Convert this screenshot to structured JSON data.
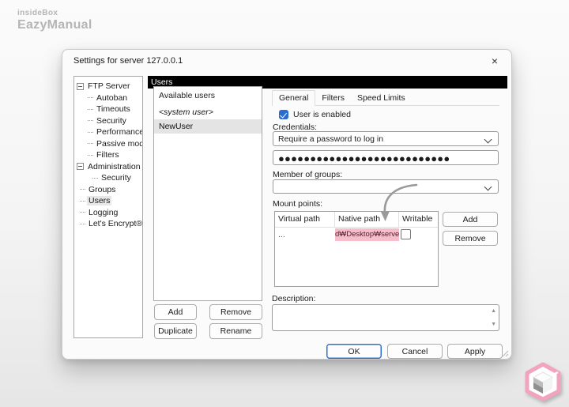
{
  "brand": {
    "line1": "insideBox",
    "line2": "EazyManual"
  },
  "dialog": {
    "title": "Settings for server 127.0.0.1",
    "close_icon": "×"
  },
  "tree": {
    "items": [
      {
        "label": "FTP Server"
      },
      {
        "label": "Autoban"
      },
      {
        "label": "Timeouts"
      },
      {
        "label": "Security"
      },
      {
        "label": "Performance"
      },
      {
        "label": "Passive mode"
      },
      {
        "label": "Filters"
      },
      {
        "label": "Administration"
      },
      {
        "label": "Security"
      },
      {
        "label": "Groups"
      },
      {
        "label": "Users"
      },
      {
        "label": "Logging"
      },
      {
        "label": "Let's Encrypt®"
      }
    ],
    "selected": "Users"
  },
  "users_panel": {
    "header": "Users",
    "list_title": "Available users",
    "items": [
      {
        "label": "<system user>",
        "selected": false
      },
      {
        "label": "NewUser",
        "selected": true
      }
    ],
    "buttons": {
      "add": "Add",
      "remove": "Remove",
      "duplicate": "Duplicate",
      "rename": "Rename"
    }
  },
  "detail": {
    "tabs": [
      {
        "label": "General",
        "active": true
      },
      {
        "label": "Filters",
        "active": false
      },
      {
        "label": "Speed Limits",
        "active": false
      }
    ],
    "user_enabled_label": "User is enabled",
    "user_enabled_checked": true,
    "credentials_label": "Credentials:",
    "credentials_value": "Require a password to log in",
    "password_mask": "●●●●●●●●●●●●●●●●●●●●●●●●●●●",
    "member_groups_label": "Member of groups:",
    "member_groups_value": "",
    "mount_points_label": "Mount points:",
    "mount_table": {
      "columns": [
        {
          "label": "Virtual path"
        },
        {
          "label": "Native path"
        },
        {
          "label": "Writable"
        }
      ],
      "row": {
        "virtual_path": "...",
        "native_path_edit": "d₩Desktop₩server",
        "writable_checked": false
      }
    },
    "mount_buttons": {
      "add": "Add",
      "remove": "Remove"
    },
    "description_label": "Description:",
    "description_value": ""
  },
  "footer": {
    "ok": "OK",
    "cancel": "Cancel",
    "apply": "Apply"
  },
  "scrollbar": {
    "up_icon": "▲",
    "down_icon": "▼"
  },
  "colors": {
    "accent_blue": "#2a6dd0",
    "selection_pink": "#f6bdcb",
    "header_black": "#000000",
    "brand_gray": "#b5b5b5",
    "watermark_pink": "#f2a3be"
  }
}
